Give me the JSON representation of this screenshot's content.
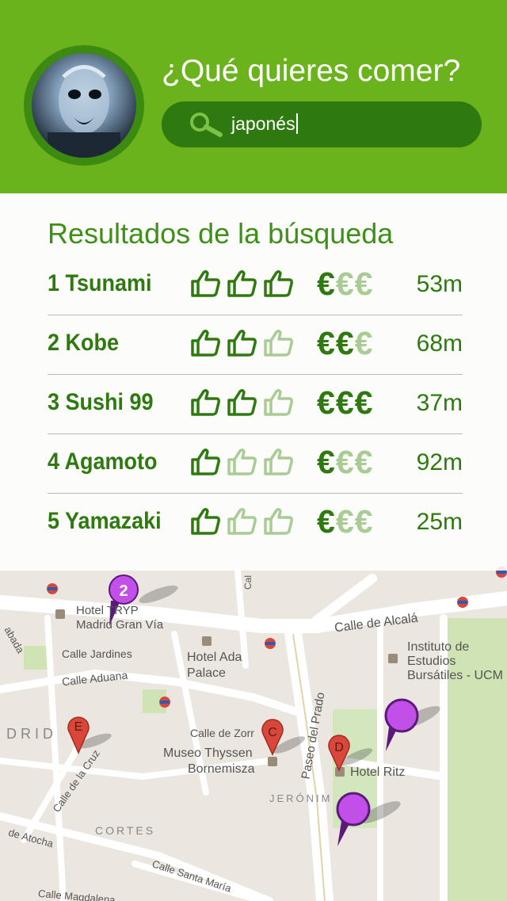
{
  "header": {
    "title": "¿Qué quieres comer?",
    "search_value": "japonés"
  },
  "results": {
    "title": "Resultados de la búsqueda",
    "rows": [
      {
        "name": "1 Tsunami",
        "thumbs": 3,
        "price": 1,
        "distance": "53m"
      },
      {
        "name": "2 Kobe",
        "thumbs": 2,
        "price": 2,
        "distance": "68m"
      },
      {
        "name": "3 Sushi 99",
        "thumbs": 2,
        "price": 3,
        "distance": "37m"
      },
      {
        "name": "4 Agamoto",
        "thumbs": 1,
        "price": 1,
        "distance": "92m"
      },
      {
        "name": "5 Yamazaki",
        "thumbs": 1,
        "price": 1,
        "distance": "25m"
      }
    ],
    "euro_symbol": "€"
  },
  "map": {
    "labels": {
      "hotel_tryp_1": "Hotel TRYP",
      "hotel_tryp_2": "Madrid Gran Vía",
      "calle_alcala": "Calle de Alcalá",
      "instituto_1": "Instituto de",
      "instituto_2": "Estudios",
      "instituto_3": "Bursátiles - UCM",
      "calle_jardines": "Calle Jardines",
      "hotel_ada_1": "Hotel Ada",
      "hotel_ada_2": "Palace",
      "calle_aduana": "Calle Aduana",
      "madrid": "DRID",
      "calle_zorrilla": "Calle de Zorr",
      "museo_1": "Museo Thyssen",
      "museo_2": "Bornemisza",
      "paseo_prado": "Paseo del Prado",
      "hotel_ritz": "Hotel Ritz",
      "jeronimos": "JERÓNIM",
      "calle_cruz": "Calle de la Cruz",
      "cortes": "CORTES",
      "atocha": "de Atocha",
      "santa_maria": "Calle Santa María",
      "magdalena": "Calle Magdalena",
      "abada": "abada",
      "calle_side": "Cal"
    },
    "pins": [
      {
        "letter": "E",
        "color": "#d9473b"
      },
      {
        "letter": "C",
        "color": "#d9473b"
      },
      {
        "letter": "D",
        "color": "#d9473b"
      },
      {
        "letter": "2",
        "color": "#b040d8"
      }
    ]
  },
  "colors": {
    "header_green": "#6ab31d",
    "dark_green": "#2f7a10",
    "faded_green": "#a9cc94"
  }
}
